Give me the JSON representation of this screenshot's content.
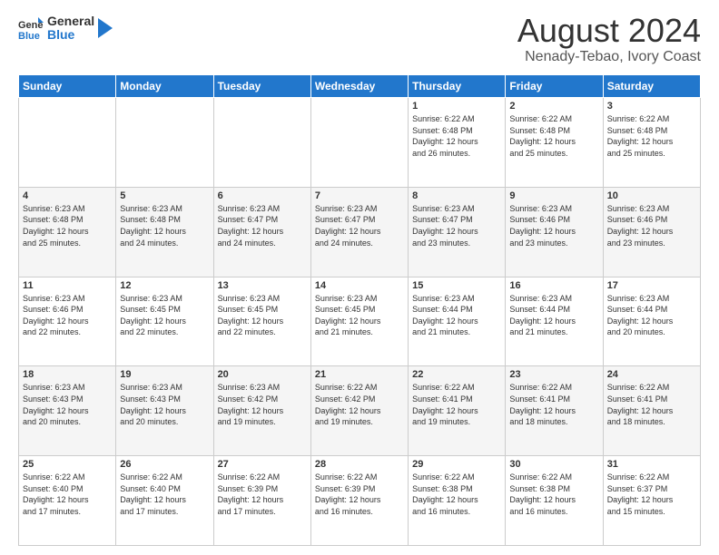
{
  "logo": {
    "line1": "General",
    "line2": "Blue"
  },
  "title": "August 2024",
  "subtitle": "Nenady-Tebao, Ivory Coast",
  "days_of_week": [
    "Sunday",
    "Monday",
    "Tuesday",
    "Wednesday",
    "Thursday",
    "Friday",
    "Saturday"
  ],
  "weeks": [
    [
      {
        "day": "",
        "info": ""
      },
      {
        "day": "",
        "info": ""
      },
      {
        "day": "",
        "info": ""
      },
      {
        "day": "",
        "info": ""
      },
      {
        "day": "1",
        "info": "Sunrise: 6:22 AM\nSunset: 6:48 PM\nDaylight: 12 hours\nand 26 minutes."
      },
      {
        "day": "2",
        "info": "Sunrise: 6:22 AM\nSunset: 6:48 PM\nDaylight: 12 hours\nand 25 minutes."
      },
      {
        "day": "3",
        "info": "Sunrise: 6:22 AM\nSunset: 6:48 PM\nDaylight: 12 hours\nand 25 minutes."
      }
    ],
    [
      {
        "day": "4",
        "info": "Sunrise: 6:23 AM\nSunset: 6:48 PM\nDaylight: 12 hours\nand 25 minutes."
      },
      {
        "day": "5",
        "info": "Sunrise: 6:23 AM\nSunset: 6:48 PM\nDaylight: 12 hours\nand 24 minutes."
      },
      {
        "day": "6",
        "info": "Sunrise: 6:23 AM\nSunset: 6:47 PM\nDaylight: 12 hours\nand 24 minutes."
      },
      {
        "day": "7",
        "info": "Sunrise: 6:23 AM\nSunset: 6:47 PM\nDaylight: 12 hours\nand 24 minutes."
      },
      {
        "day": "8",
        "info": "Sunrise: 6:23 AM\nSunset: 6:47 PM\nDaylight: 12 hours\nand 23 minutes."
      },
      {
        "day": "9",
        "info": "Sunrise: 6:23 AM\nSunset: 6:46 PM\nDaylight: 12 hours\nand 23 minutes."
      },
      {
        "day": "10",
        "info": "Sunrise: 6:23 AM\nSunset: 6:46 PM\nDaylight: 12 hours\nand 23 minutes."
      }
    ],
    [
      {
        "day": "11",
        "info": "Sunrise: 6:23 AM\nSunset: 6:46 PM\nDaylight: 12 hours\nand 22 minutes."
      },
      {
        "day": "12",
        "info": "Sunrise: 6:23 AM\nSunset: 6:45 PM\nDaylight: 12 hours\nand 22 minutes."
      },
      {
        "day": "13",
        "info": "Sunrise: 6:23 AM\nSunset: 6:45 PM\nDaylight: 12 hours\nand 22 minutes."
      },
      {
        "day": "14",
        "info": "Sunrise: 6:23 AM\nSunset: 6:45 PM\nDaylight: 12 hours\nand 21 minutes."
      },
      {
        "day": "15",
        "info": "Sunrise: 6:23 AM\nSunset: 6:44 PM\nDaylight: 12 hours\nand 21 minutes."
      },
      {
        "day": "16",
        "info": "Sunrise: 6:23 AM\nSunset: 6:44 PM\nDaylight: 12 hours\nand 21 minutes."
      },
      {
        "day": "17",
        "info": "Sunrise: 6:23 AM\nSunset: 6:44 PM\nDaylight: 12 hours\nand 20 minutes."
      }
    ],
    [
      {
        "day": "18",
        "info": "Sunrise: 6:23 AM\nSunset: 6:43 PM\nDaylight: 12 hours\nand 20 minutes."
      },
      {
        "day": "19",
        "info": "Sunrise: 6:23 AM\nSunset: 6:43 PM\nDaylight: 12 hours\nand 20 minutes."
      },
      {
        "day": "20",
        "info": "Sunrise: 6:23 AM\nSunset: 6:42 PM\nDaylight: 12 hours\nand 19 minutes."
      },
      {
        "day": "21",
        "info": "Sunrise: 6:22 AM\nSunset: 6:42 PM\nDaylight: 12 hours\nand 19 minutes."
      },
      {
        "day": "22",
        "info": "Sunrise: 6:22 AM\nSunset: 6:41 PM\nDaylight: 12 hours\nand 19 minutes."
      },
      {
        "day": "23",
        "info": "Sunrise: 6:22 AM\nSunset: 6:41 PM\nDaylight: 12 hours\nand 18 minutes."
      },
      {
        "day": "24",
        "info": "Sunrise: 6:22 AM\nSunset: 6:41 PM\nDaylight: 12 hours\nand 18 minutes."
      }
    ],
    [
      {
        "day": "25",
        "info": "Sunrise: 6:22 AM\nSunset: 6:40 PM\nDaylight: 12 hours\nand 17 minutes."
      },
      {
        "day": "26",
        "info": "Sunrise: 6:22 AM\nSunset: 6:40 PM\nDaylight: 12 hours\nand 17 minutes."
      },
      {
        "day": "27",
        "info": "Sunrise: 6:22 AM\nSunset: 6:39 PM\nDaylight: 12 hours\nand 17 minutes."
      },
      {
        "day": "28",
        "info": "Sunrise: 6:22 AM\nSunset: 6:39 PM\nDaylight: 12 hours\nand 16 minutes."
      },
      {
        "day": "29",
        "info": "Sunrise: 6:22 AM\nSunset: 6:38 PM\nDaylight: 12 hours\nand 16 minutes."
      },
      {
        "day": "30",
        "info": "Sunrise: 6:22 AM\nSunset: 6:38 PM\nDaylight: 12 hours\nand 16 minutes."
      },
      {
        "day": "31",
        "info": "Sunrise: 6:22 AM\nSunset: 6:37 PM\nDaylight: 12 hours\nand 15 minutes."
      }
    ]
  ]
}
